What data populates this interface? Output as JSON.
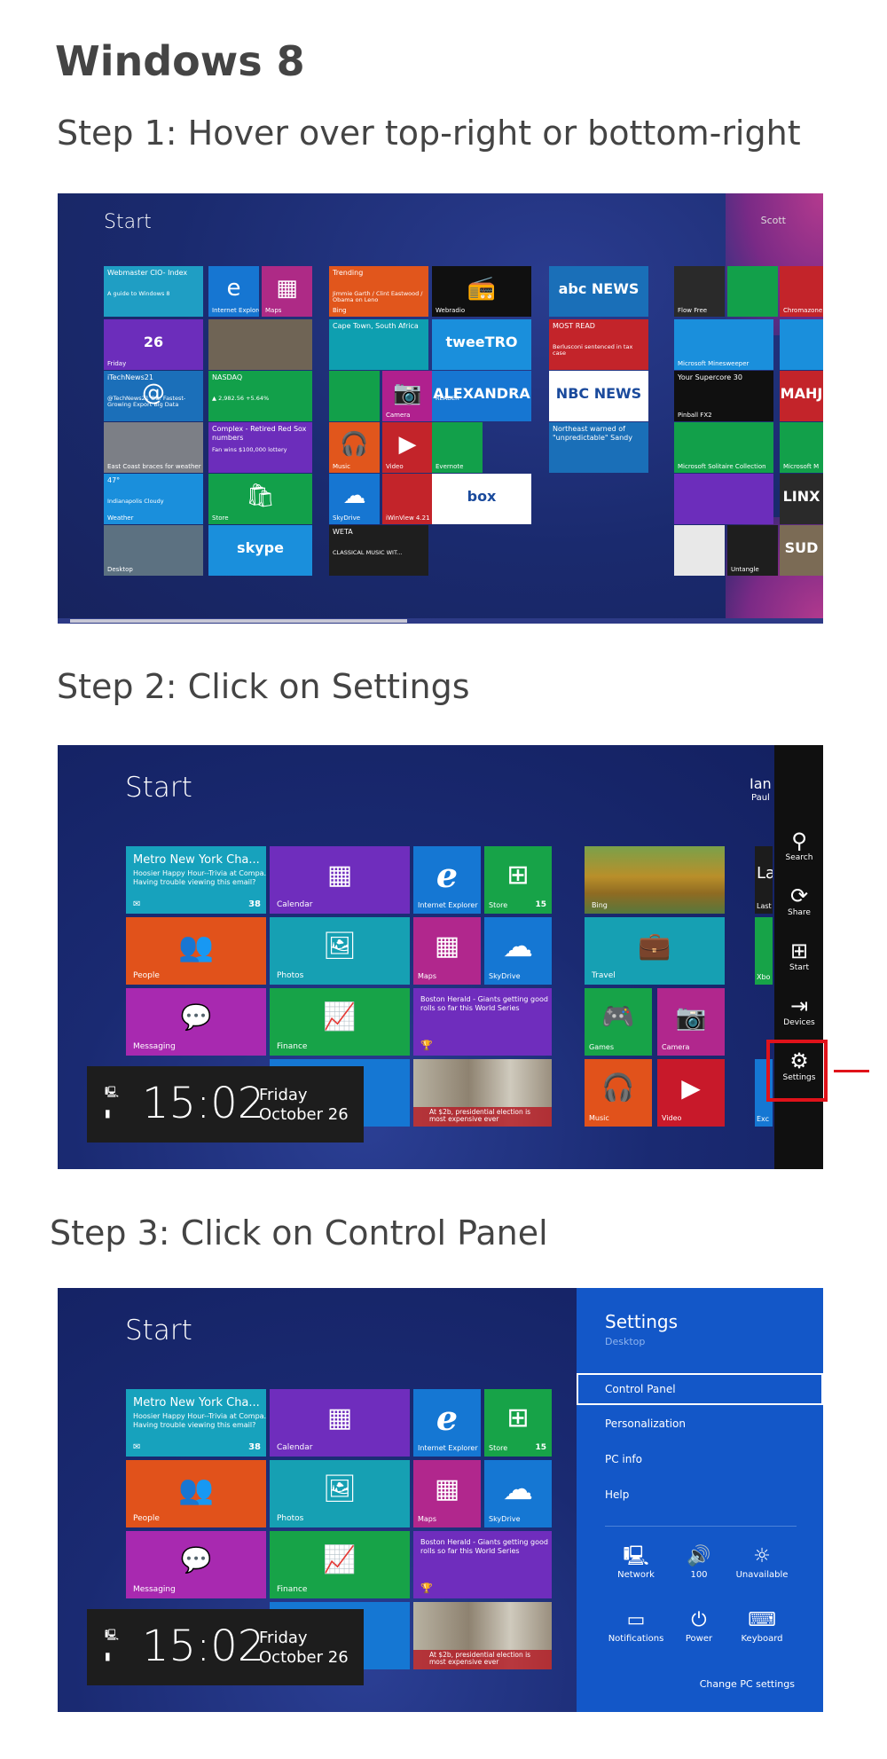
{
  "title": "Windows 8",
  "step1": {
    "heading": "Step 1: Hover over top-right or bottom-right",
    "start_label": "Start",
    "user": "Scott",
    "tiles": [
      {
        "text": "Webmaster CIO- Index",
        "sub": "A guide to Windows 8",
        "lbl": "",
        "color": "#1f9ec4"
      },
      {
        "text": "",
        "lbl": "Internet Explorer",
        "icon": "e",
        "color": "#1676d2"
      },
      {
        "text": "",
        "lbl": "Maps",
        "icon": "▦",
        "color": "#ae2a86"
      },
      {
        "text": "26",
        "lbl": "Friday",
        "color": "#6c2dbb"
      },
      {
        "text": "",
        "lbl": "",
        "color": "#6f6455"
      },
      {
        "text": "iTechNews21",
        "sub": "@TechNews21 Our Fastest-Growing Export Big Data",
        "lbl": "",
        "icon": "@",
        "color": "#1b6fb9"
      },
      {
        "text": "NASDAQ",
        "sub": "▲ 2,982.56  +5.64%",
        "lbl": "",
        "color": "#12a04a"
      },
      {
        "text": "",
        "lbl": "East Coast braces for weather",
        "color": "#7c7f86"
      },
      {
        "text": "Complex - Retired Red Sox numbers",
        "sub": "Fan wins $100,000 lottery",
        "lbl": "",
        "color": "#6c2dbb"
      },
      {
        "text": "47°",
        "sub": "Indianapolis Cloudy",
        "lbl": "Weather",
        "color": "#1a8fdc"
      },
      {
        "text": "",
        "lbl": "Store",
        "icon": "🛍",
        "color": "#12a04a"
      },
      {
        "text": "",
        "lbl": "Desktop",
        "color": "#5c7181"
      },
      {
        "text": "skype",
        "lbl": "",
        "color": "#1a8fdc"
      },
      {
        "text": "Trending",
        "sub": "Jimmie Garth / Clint Eastwood / Obama on Leno",
        "lbl": "Bing",
        "color": "#e1561c"
      },
      {
        "text": "",
        "lbl": "Webradio",
        "icon": "📻",
        "color": "#101010"
      },
      {
        "text": "abc NEWS",
        "lbl": "",
        "color": "#1a6fb8"
      },
      {
        "text": "Cape Town, South Africa",
        "lbl": "",
        "color": "#0e9fb0"
      },
      {
        "text": "tweeTRO",
        "lbl": "",
        "color": "#1a8fdc"
      },
      {
        "text": "MOST READ",
        "sub": "Berlusconi sentenced in tax case",
        "lbl": "",
        "color": "#c3242a"
      },
      {
        "text": "",
        "lbl": "",
        "color": "#12a04a"
      },
      {
        "text": "",
        "lbl": "Camera",
        "icon": "📷",
        "color": "#b0208e"
      },
      {
        "text": "ALEXANDRA",
        "sub": "READER",
        "lbl": "",
        "color": "#1676d2"
      },
      {
        "text": "NBC NEWS",
        "lbl": "",
        "color": "#ffffff"
      },
      {
        "text": "",
        "lbl": "Music",
        "icon": "🎧",
        "color": "#e1561c"
      },
      {
        "text": "",
        "lbl": "Video",
        "icon": "▶",
        "color": "#c3242a"
      },
      {
        "text": "",
        "lbl": "Evernote",
        "color": "#12a04a"
      },
      {
        "text": "Northeast warned of \"unpredictable\" Sandy",
        "lbl": "",
        "color": "#1a6fb8"
      },
      {
        "text": "",
        "lbl": "SkyDrive",
        "icon": "☁",
        "color": "#1676d2"
      },
      {
        "text": "",
        "lbl": "iWinView 4.21",
        "color": "#c3242a"
      },
      {
        "text": "box",
        "lbl": "",
        "color": "#ffffff"
      },
      {
        "text": "WETA",
        "sub": "CLASSICAL MUSIC WIT...",
        "lbl": "",
        "color": "#1e1e1e"
      },
      {
        "text": "",
        "lbl": "Flow Free",
        "color": "#2a2a2a"
      },
      {
        "text": "",
        "lbl": "",
        "color": "#12a04a"
      },
      {
        "text": "",
        "lbl": "Chromazone",
        "color": "#c3242a"
      },
      {
        "text": "",
        "lbl": "Microsoft Minesweeper",
        "color": "#1a8fdc"
      },
      {
        "text": "",
        "lbl": "",
        "color": "#1a8fdc"
      },
      {
        "text": "Your Supercore 30",
        "lbl": "Pinball FX2",
        "color": "#101010"
      },
      {
        "text": "MAHJ",
        "lbl": "",
        "color": "#c3242a"
      },
      {
        "text": "",
        "lbl": "Microsoft Solitaire Collection",
        "color": "#12a04a"
      },
      {
        "text": "",
        "lbl": "Microsoft M",
        "color": "#12a04a"
      },
      {
        "text": "",
        "lbl": "",
        "color": "#6c2dbb"
      },
      {
        "text": "LINX",
        "lbl": "",
        "color": "#2a2a2a"
      },
      {
        "text": "",
        "lbl": "",
        "color": "#e8e8e8"
      },
      {
        "text": "",
        "lbl": "Untangle",
        "color": "#1e1e1e"
      },
      {
        "text": "SUD",
        "lbl": "",
        "color": "#7b6b55"
      }
    ]
  },
  "step2": {
    "heading": "Step 2: Click on Settings",
    "start_label": "Start",
    "user_name": "Ian",
    "user_sub": "Paul",
    "tiles": {
      "mail_title": "Metro New York Cha...",
      "mail_sub": "Hoosier Happy Hour--Trivia at Compa...",
      "mail_sub2": "Having trouble viewing this email?",
      "mail_badge": "38",
      "calendar": "Calendar",
      "ie": "Internet Explorer",
      "store": "Store",
      "store_badge": "15",
      "bing": "Bing",
      "people": "People",
      "photos": "Photos",
      "maps": "Maps",
      "skydrive": "SkyDrive",
      "travel": "Travel",
      "messaging": "Messaging",
      "finance": "Finance",
      "news_text": "Boston Herald - Giants getting good rolls so far this World Series",
      "games": "Games",
      "camera": "Camera",
      "news2_text": "At $2b, presidential election is most expensive ever",
      "music": "Music",
      "video": "Video",
      "edge1": "La",
      "edge2": "Last",
      "edge3": "Xbo",
      "edge4": "Exc"
    },
    "clock": {
      "time": "15:02",
      "day": "Friday",
      "date": "October 26"
    },
    "charms": [
      {
        "label": "Search",
        "icon": "⚲"
      },
      {
        "label": "Share",
        "icon": "⟳"
      },
      {
        "label": "Start",
        "icon": "⊞"
      },
      {
        "label": "Devices",
        "icon": "⇥"
      },
      {
        "label": "Settings",
        "icon": "⚙"
      }
    ],
    "highlight_color": "#e0121a"
  },
  "step3": {
    "heading": "Step 3: Click on Control Panel",
    "start_label": "Start",
    "clock": {
      "time": "15:02",
      "day": "Friday",
      "date": "October 26"
    },
    "settings": {
      "title": "Settings",
      "context": "Desktop",
      "items": [
        "Control Panel",
        "Personalization",
        "PC info",
        "Help"
      ],
      "quick": [
        {
          "label": "Network",
          "icon": "🖳"
        },
        {
          "label": "100",
          "icon": "🔊"
        },
        {
          "label": "Unavailable",
          "icon": "☼"
        },
        {
          "label": "Notifications",
          "icon": "▭"
        },
        {
          "label": "Power",
          "icon": "⏻"
        },
        {
          "label": "Keyboard",
          "icon": "⌨"
        }
      ],
      "change": "Change PC settings",
      "panel_color": "#1357c8"
    }
  }
}
